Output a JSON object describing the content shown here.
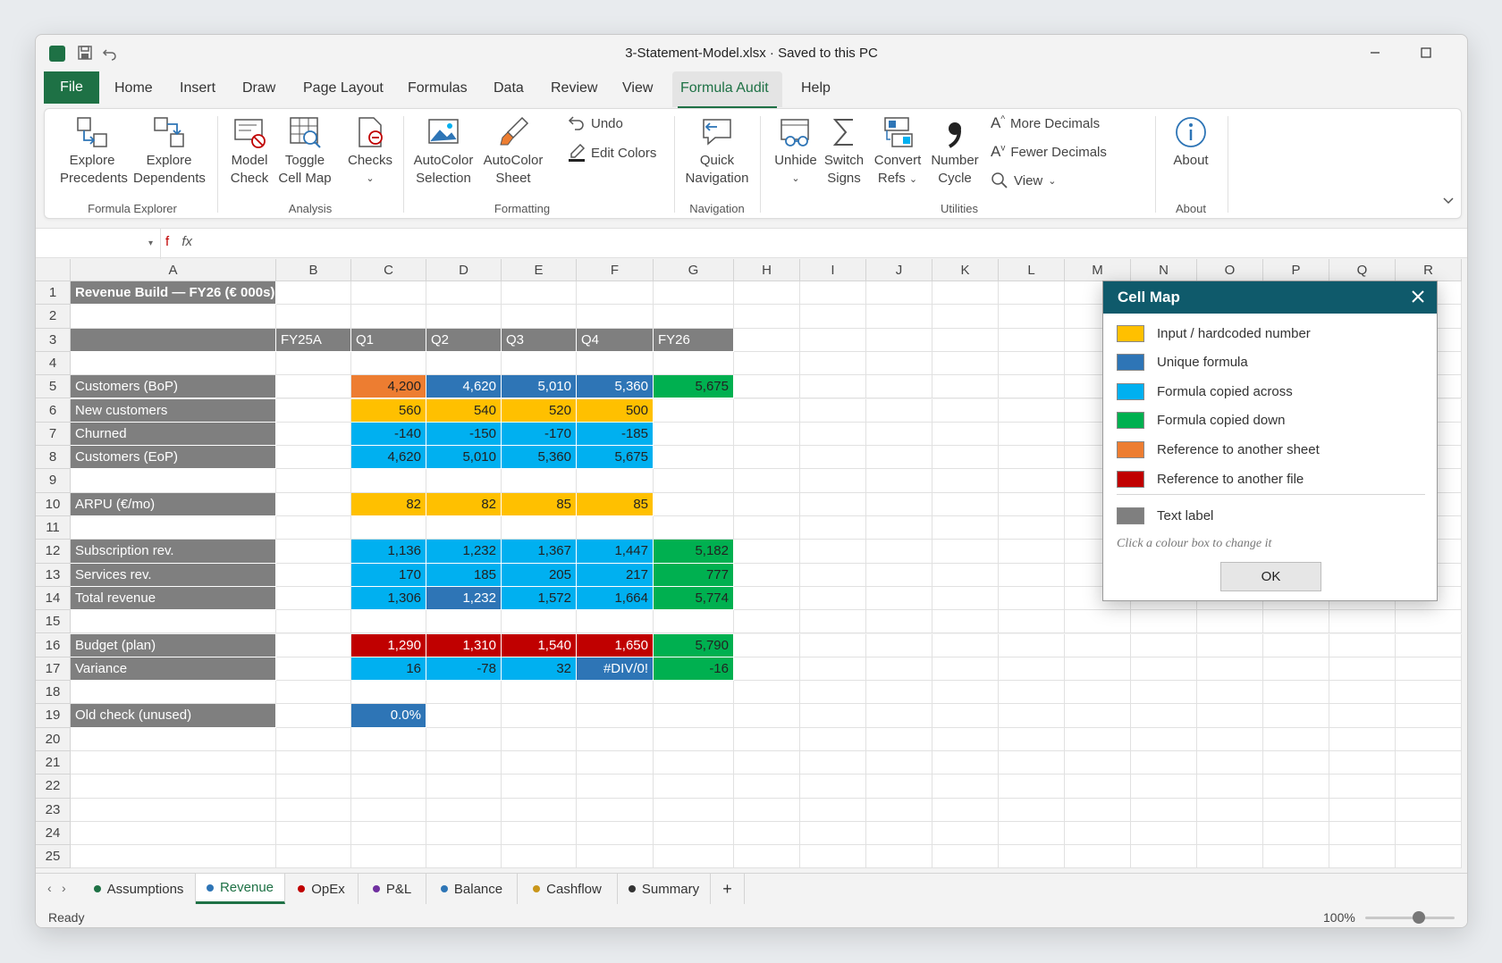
{
  "window": {
    "title": "3-Statement-Model.xlsx · Saved to this PC"
  },
  "menu": {
    "file": "File",
    "items": [
      "Home",
      "Insert",
      "Draw",
      "Page Layout",
      "Formulas",
      "Data",
      "Review",
      "View",
      "Formula Audit",
      "Help"
    ],
    "active": "Formula Audit"
  },
  "ribbon": {
    "explore_precedents": [
      "Explore",
      "Precedents"
    ],
    "explore_dependents": [
      "Explore",
      "Dependents"
    ],
    "model_check": [
      "Model",
      "Check"
    ],
    "toggle_cell_map": [
      "Toggle",
      "Cell Map"
    ],
    "checks": "Checks",
    "autocolor_selection": [
      "AutoColor",
      "Selection"
    ],
    "autocolor_sheet": [
      "AutoColor",
      "Sheet"
    ],
    "undo": "Undo",
    "edit_colors": "Edit Colors",
    "quick_navigation": [
      "Quick",
      "Navigation"
    ],
    "unhide": "Unhide",
    "switch_signs": [
      "Switch",
      "Signs"
    ],
    "convert_refs": [
      "Convert",
      "Refs"
    ],
    "number_cycle": [
      "Number",
      "Cycle"
    ],
    "more_decimals": "More Decimals",
    "fewer_decimals": "Fewer Decimals",
    "view": "View",
    "about": "About",
    "groups": {
      "formula_explorer": "Formula Explorer",
      "analysis": "Analysis",
      "formatting": "Formatting",
      "navigation": "Navigation",
      "utilities": "Utilities",
      "about": "About"
    }
  },
  "formula_bar": {
    "name_box": "",
    "fx": "fx",
    "cancel": "f"
  },
  "columns": [
    "A",
    "B",
    "C",
    "D",
    "E",
    "F",
    "G",
    "H",
    "I",
    "J",
    "K",
    "L",
    "M",
    "N",
    "O",
    "P",
    "Q",
    "R"
  ],
  "rows": [
    "1",
    "2",
    "3",
    "4",
    "5",
    "6",
    "7",
    "8",
    "9",
    "10",
    "11",
    "12",
    "13",
    "14",
    "15",
    "16",
    "17",
    "18",
    "19",
    "20",
    "21",
    "22",
    "23",
    "24",
    "25"
  ],
  "sheet": {
    "title": "Revenue Build — FY26 (€ 000s)",
    "headers": {
      "B": "FY25A",
      "C": "Q1",
      "D": "Q2",
      "E": "Q3",
      "F": "Q4",
      "G": "FY26"
    },
    "cells": [
      {
        "r": 5,
        "label": "Customers (BoP)",
        "vals": {
          "C": [
            "4,200",
            "sheet"
          ],
          "D": [
            "4,620",
            "unique"
          ],
          "E": [
            "5,010",
            "unique"
          ],
          "F": [
            "5,360",
            "unique"
          ],
          "G": [
            "5,675",
            "down"
          ]
        }
      },
      {
        "r": 6,
        "label": "New customers",
        "vals": {
          "C": [
            "560",
            "input"
          ],
          "D": [
            "540",
            "input"
          ],
          "E": [
            "520",
            "input"
          ],
          "F": [
            "500",
            "input"
          ]
        }
      },
      {
        "r": 7,
        "label": "Churned",
        "vals": {
          "C": [
            "-140",
            "across"
          ],
          "D": [
            "-150",
            "across"
          ],
          "E": [
            "-170",
            "across"
          ],
          "F": [
            "-185",
            "across"
          ]
        }
      },
      {
        "r": 8,
        "label": "Customers (EoP)",
        "vals": {
          "C": [
            "4,620",
            "across"
          ],
          "D": [
            "5,010",
            "across"
          ],
          "E": [
            "5,360",
            "across"
          ],
          "F": [
            "5,675",
            "across"
          ]
        }
      },
      {
        "r": 10,
        "label": "ARPU (€/mo)",
        "vals": {
          "C": [
            "82",
            "input"
          ],
          "D": [
            "82",
            "input"
          ],
          "E": [
            "85",
            "input"
          ],
          "F": [
            "85",
            "input"
          ]
        }
      },
      {
        "r": 12,
        "label": "Subscription rev.",
        "vals": {
          "C": [
            "1,136",
            "across"
          ],
          "D": [
            "1,232",
            "across"
          ],
          "E": [
            "1,367",
            "across"
          ],
          "F": [
            "1,447",
            "across"
          ],
          "G": [
            "5,182",
            "down"
          ]
        }
      },
      {
        "r": 13,
        "label": "Services rev.",
        "vals": {
          "C": [
            "170",
            "across"
          ],
          "D": [
            "185",
            "across"
          ],
          "E": [
            "205",
            "across"
          ],
          "F": [
            "217",
            "across"
          ],
          "G": [
            "777",
            "down"
          ]
        }
      },
      {
        "r": 14,
        "label": "Total revenue",
        "vals": {
          "C": [
            "1,306",
            "across"
          ],
          "D": [
            "1,232",
            "unique"
          ],
          "E": [
            "1,572",
            "across"
          ],
          "F": [
            "1,664",
            "across"
          ],
          "G": [
            "5,774",
            "down"
          ]
        }
      },
      {
        "r": 16,
        "label": "Budget (plan)",
        "vals": {
          "C": [
            "1,290",
            "file"
          ],
          "D": [
            "1,310",
            "file"
          ],
          "E": [
            "1,540",
            "file"
          ],
          "F": [
            "1,650",
            "file"
          ],
          "G": [
            "5,790",
            "down"
          ]
        }
      },
      {
        "r": 17,
        "label": "Variance",
        "vals": {
          "C": [
            "16",
            "across"
          ],
          "D": [
            "-78",
            "across"
          ],
          "E": [
            "32",
            "across"
          ],
          "F": [
            "#DIV/0!",
            "unique"
          ],
          "G": [
            "-16",
            "down"
          ]
        }
      },
      {
        "r": 19,
        "label": "Old check (unused)",
        "vals": {
          "C": [
            "0.0%",
            "unique"
          ]
        }
      }
    ]
  },
  "sheet_tabs": [
    {
      "name": "Assumptions",
      "color": "#1e7145"
    },
    {
      "name": "Revenue",
      "color": "#2e75b6",
      "active": true
    },
    {
      "name": "OpEx",
      "color": "#c00000"
    },
    {
      "name": "P&L",
      "color": "#7030a0"
    },
    {
      "name": "Balance",
      "color": "#2e75b6"
    },
    {
      "name": "Cashflow",
      "color": "#c9961a"
    },
    {
      "name": "Summary",
      "color": "#333333"
    }
  ],
  "add_sheet": "+",
  "status": {
    "ready": "Ready",
    "zoom": "100%",
    "zoom_fraction": 0.6
  },
  "cell_map": {
    "title": "Cell Map",
    "legend": [
      {
        "label": "Input / hardcoded number",
        "color": "#ffc000"
      },
      {
        "label": "Unique formula",
        "color": "#2e75b6"
      },
      {
        "label": "Formula copied across",
        "color": "#00b0f0"
      },
      {
        "label": "Formula copied down",
        "color": "#00b050"
      },
      {
        "label": "Reference to another sheet",
        "color": "#ed7d31"
      },
      {
        "label": "Reference to another file",
        "color": "#c00000"
      }
    ],
    "text_label": {
      "label": "Text label",
      "color": "#7f7f7f"
    },
    "hint": "Click a colour box to change it",
    "ok": "OK"
  },
  "colors": {
    "brand": "#1e7145",
    "dialog_header": "#0f5a6b"
  }
}
